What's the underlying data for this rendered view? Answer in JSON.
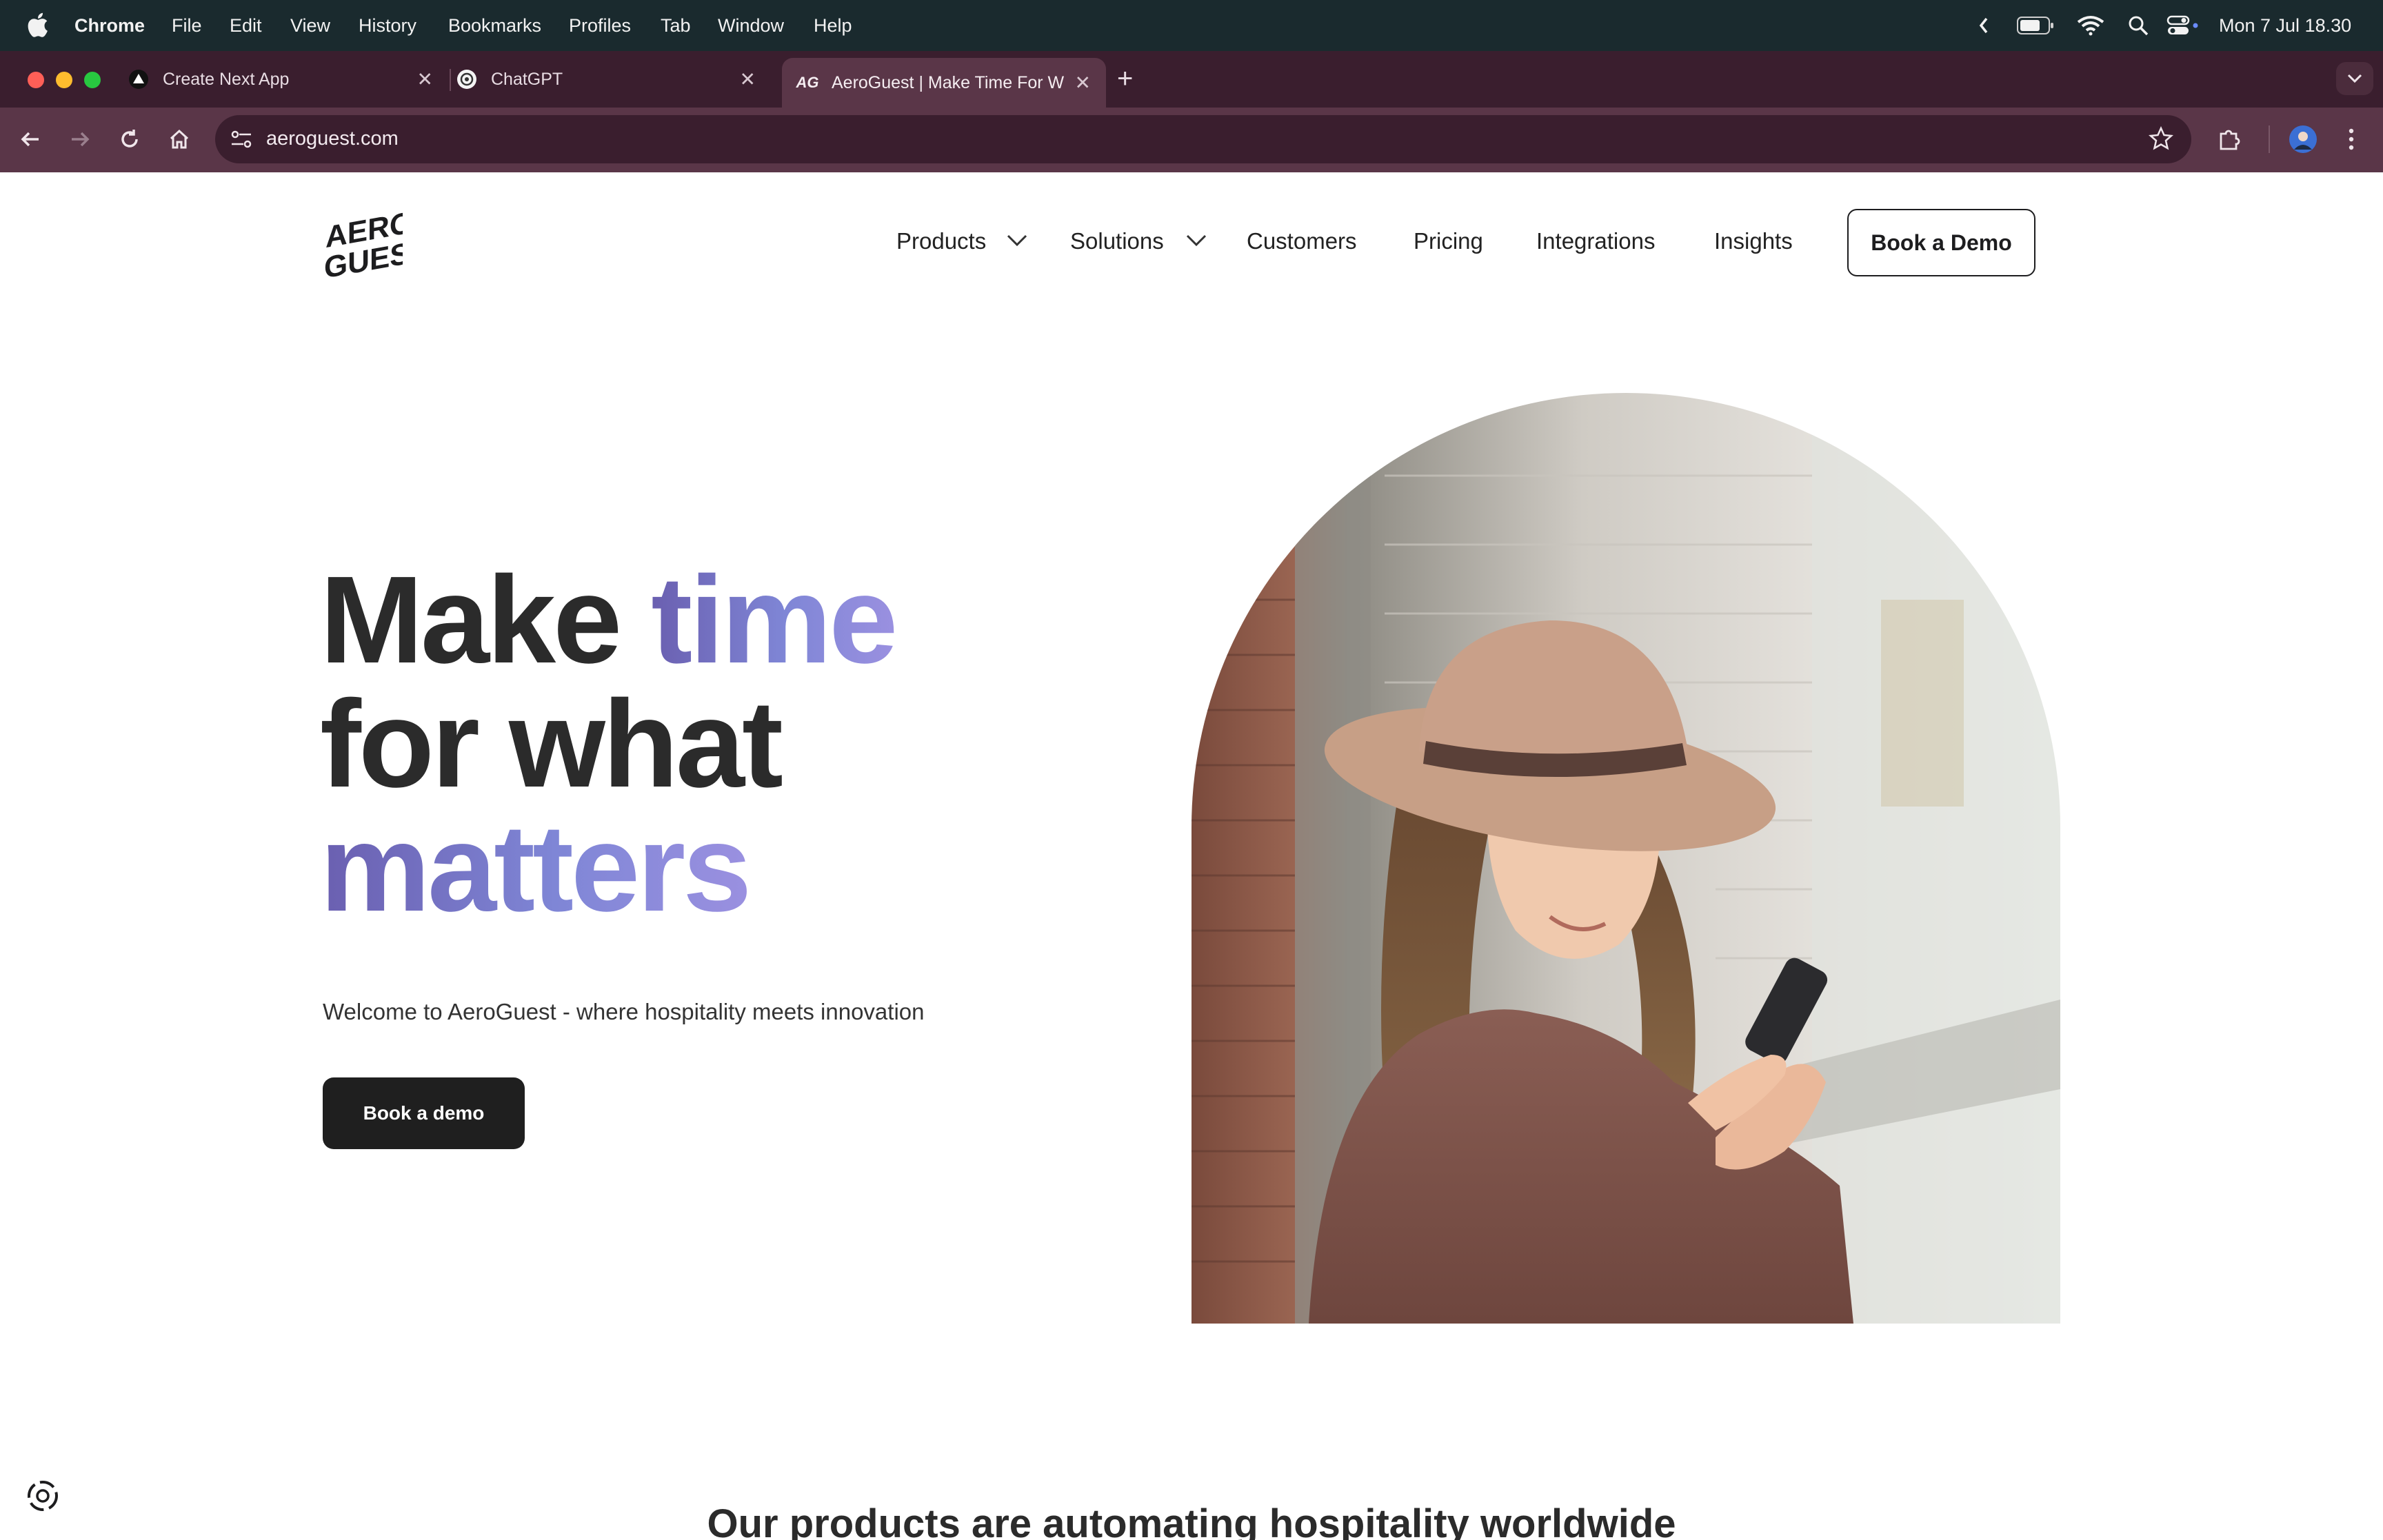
{
  "menubar": {
    "app_name": "Chrome",
    "items": [
      "File",
      "Edit",
      "View",
      "History",
      "Bookmarks",
      "Profiles",
      "Tab",
      "Window",
      "Help"
    ],
    "clock": "Mon 7 Jul  18.30"
  },
  "tabs": [
    {
      "title": "Create Next App",
      "icon": "triangle-icon"
    },
    {
      "title": "ChatGPT",
      "icon": "chatgpt-icon"
    },
    {
      "title": "AeroGuest | Make Time For W",
      "icon": "aeroguest-icon",
      "favicon_text": "AG"
    }
  ],
  "address_bar": {
    "url": "aeroguest.com"
  },
  "site": {
    "logo": {
      "line1": "AERO",
      "line2": "GUEST"
    },
    "nav": {
      "products": "Products",
      "solutions": "Solutions",
      "customers": "Customers",
      "pricing": "Pricing",
      "integrations": "Integrations",
      "insights": "Insights",
      "cta": "Book a Demo"
    },
    "hero": {
      "line1_a": "Make ",
      "line1_b": "time",
      "line2": "for what",
      "line3": "matters",
      "subtitle": "Welcome to AeroGuest - where hospitality meets innovation",
      "cta": "Book a demo"
    },
    "section_heading": "Our products are automating hospitality worldwide"
  },
  "colors": {
    "accent_gradient_start": "#6a5fb0",
    "accent_gradient_end": "#9a90e0",
    "primary_dark": "#1f1f1f",
    "tabstrip": "#3a1e2e",
    "toolbar": "#5a3648"
  }
}
